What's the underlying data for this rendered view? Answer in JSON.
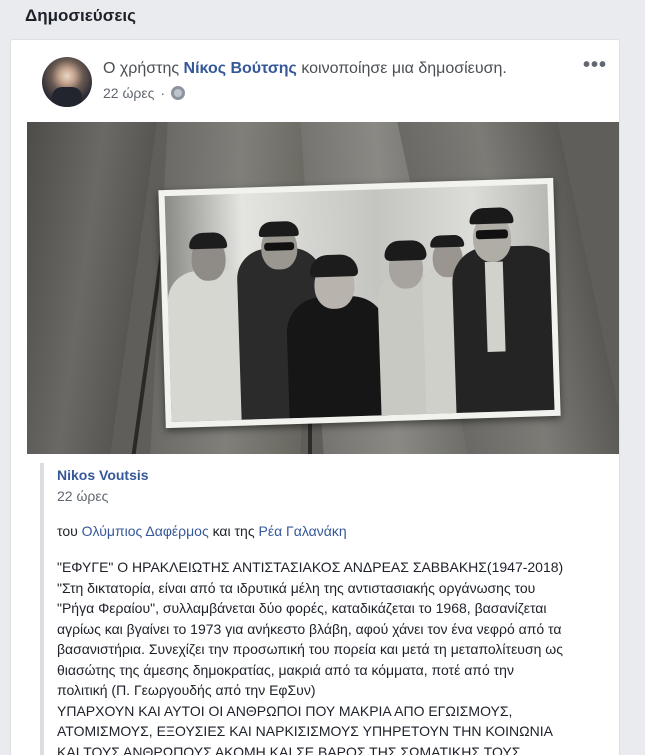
{
  "section": {
    "title": "Δημοσιεύσεις"
  },
  "post": {
    "header_prefix": "Ο χρήστης",
    "user_name": "Νίκος Βούτσης",
    "header_suffix": "κοινοποίησε μια δημοσίευση.",
    "time": "22 ώρες",
    "privacy_icon": "globe-icon",
    "more_icon": "more-options-icon",
    "more_label": "•••"
  },
  "shared": {
    "author": "Nikos Voutsis",
    "time": "22 ώρες",
    "tag_prefix": "του",
    "tag_person_1": "Ολύμπιος Δαφέρμος",
    "tag_middle": "και της",
    "tag_person_2": "Ρέα Γαλανάκη",
    "lines": [
      "\"ΕΦΥΓΕ\" Ο ΗΡΑΚΛΕΙΩΤΗΣ ΑΝΤΙΣΤΑΣΙΑΚΟΣ ΑΝΔΡΕΑΣ ΣΑΒΒΑΚΗΣ(1947-2018)",
      "\"Στη δικτατορία, είναι από τα ιδρυτικά μέλη της αντιστασιακής οργάνωσης του",
      "\"Ρήγα Φεραίου\", συλλαμβάνεται δύο φορές, καταδικάζεται το 1968, βασανίζεται",
      "αγρίως και βγαίνει το 1973 για ανήκεστο βλάβη, αφού χάνει τον ένα νεφρό από τα",
      "βασανιστήρια. Συνεχίζει την προσωπική του πορεία και μετά τη μεταπολίτευση ως",
      "θιασώτης της άμεσης δημοκρατίας, μακριά από τα κόμματα, ποτέ από την",
      "πολιτική (Π. Γεωργουδής από την ΕφΣυν)",
      "ΥΠΑΡΧΟΥΝ ΚΑΙ ΑΥΤΟΙ ΟΙ ΑΝΘΡΩΠΟΙ ΠΟΥ ΜΑΚΡΙΑ ΑΠΟ ΕΓΩΙΣΜΟΥΣ,",
      "ΑΤΟΜΙΣΜΟΥΣ, ΕΞΟΥΣΙΕΣ ΚΑΙ ΝΑΡΚΙΣΙΣΜΟΥΣ ΥΠΗΡΕΤΟΥΝ ΤΗΝ ΚΟΙΝΩΝΙΑ",
      "ΚΑΙ ΤΟΥΣ ΑΝΘΡΩΠΟΥΣ ΑΚΟΜΗ ΚΑΙ ΣΕ ΒΑΡΟΣ ΤΗΣ ΣΩΜΑΤΙΚΗΣ ΤΟΥΣ"
    ]
  }
}
